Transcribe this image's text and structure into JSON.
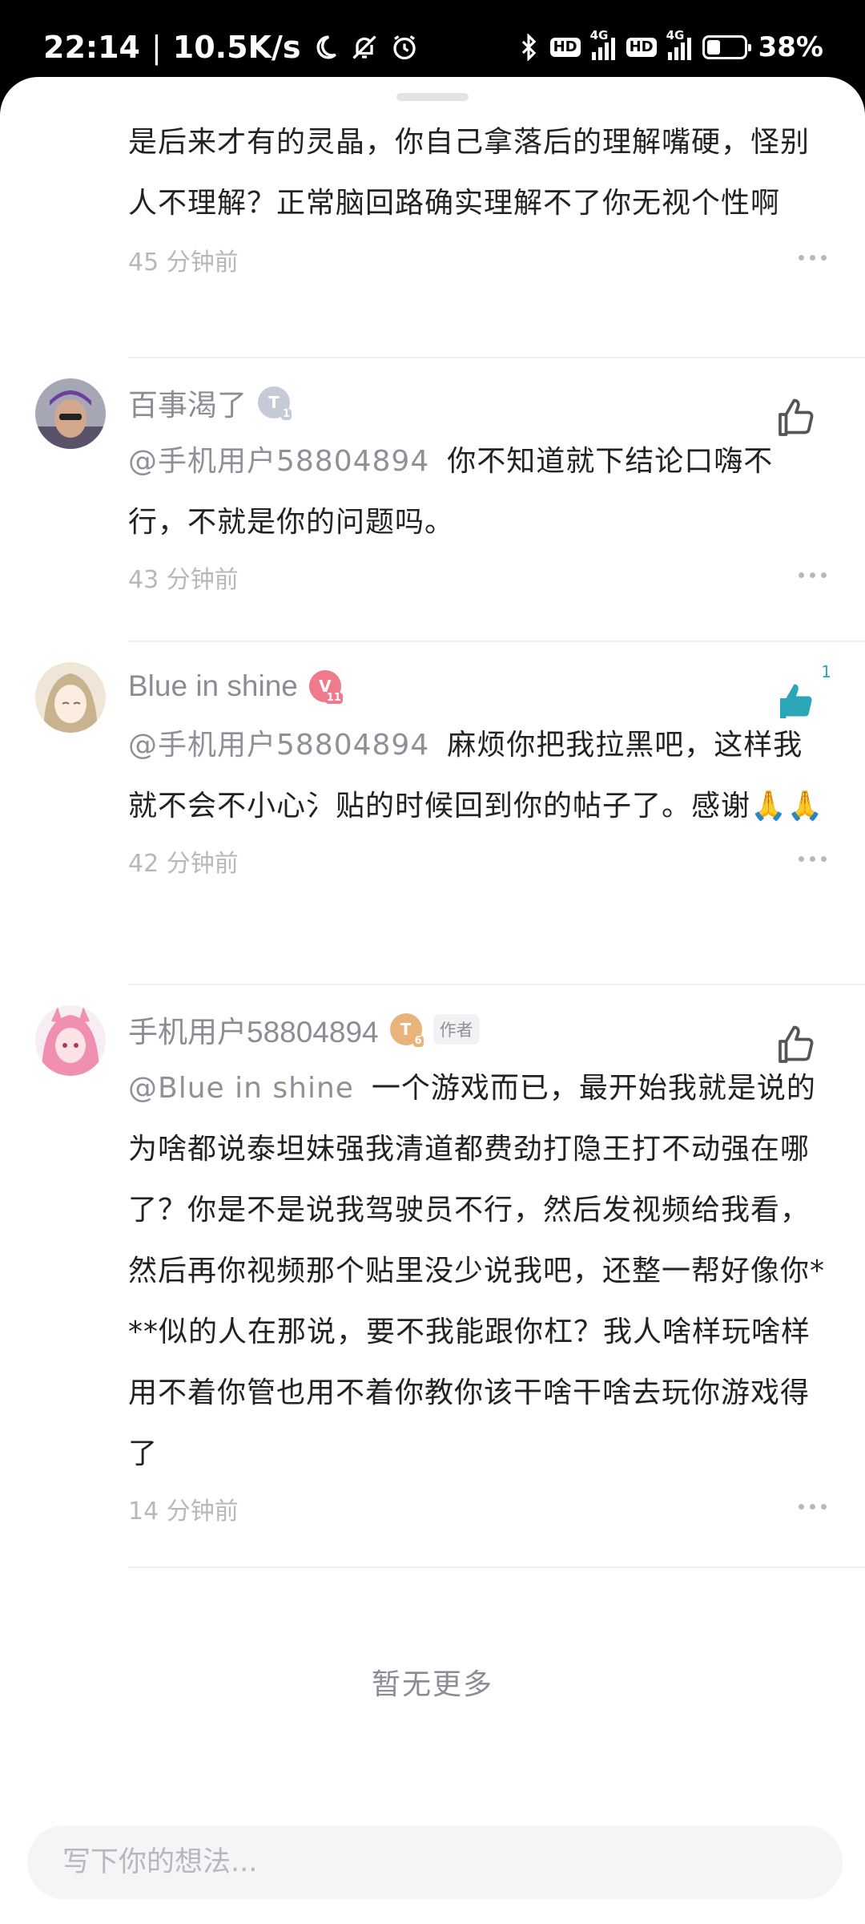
{
  "status_bar": {
    "time": "22:14",
    "speed": "10.5K/s",
    "battery": "38%",
    "net_label": "4G",
    "hd_label": "HD"
  },
  "comments": [
    {
      "text": "是后来才有的灵晶，你自己拿落后的理解嘴硬，怪别人不理解？正常脑回路确实理解不了你无视个性啊",
      "time": "45 分钟前"
    },
    {
      "name": "百事渴了",
      "level": "T",
      "level_sub": "1",
      "mention": "@手机用户58804894",
      "text": "你不知道就下结论口嗨不行，不就是你的问题吗。",
      "time": "43 分钟前",
      "liked": false
    },
    {
      "name": "Blue in shine",
      "level": "V",
      "level_sub": "11",
      "mention": "@手机用户58804894",
      "text": "麻烦你把我拉黑吧，这样我就不会不小心氵贴的时候回到你的帖子了。感谢🙏🙏",
      "time": "42 分钟前",
      "liked": true,
      "like_count": "1"
    },
    {
      "name": "手机用户58804894",
      "level": "T",
      "level_sub": "6",
      "author_tag": "作者",
      "mention": "@Blue in shine",
      "text": "一个游戏而已，最开始我就是说的为啥都说泰坦妹强我清道都费劲打隐王打不动强在哪了？你是不是说我驾驶员不行，然后发视频给我看，然后再你视频那个贴里没少说我吧，还整一帮好像你***似的人在那说，要不我能跟你杠？我人啥样玩啥样用不着你管也用不着你教你该干啥干啥去玩你游戏得了",
      "time": "14 分钟前",
      "liked": false
    }
  ],
  "footer_text": "暂无更多",
  "input": {
    "placeholder": "写下你的想法..."
  },
  "colors": {
    "accent_like": "#2aa6b8",
    "text_primary": "#222222",
    "text_secondary": "#8a8d94"
  }
}
